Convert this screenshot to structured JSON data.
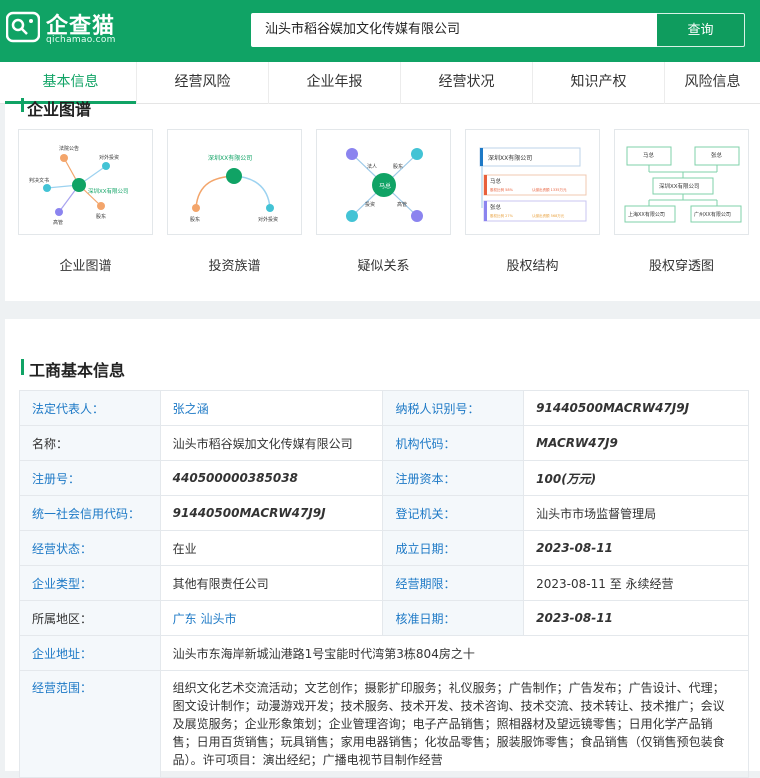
{
  "header": {
    "logo_text": "企查猫",
    "logo_sub": "qichamao.com",
    "search_value": "汕头市稻谷娱加文化传媒有限公司",
    "search_button": "查询"
  },
  "tabs": [
    "基本信息",
    "经营风险",
    "企业年报",
    "经营状况",
    "知识产权",
    "风险信息"
  ],
  "graph_section": {
    "title": "企业图谱",
    "items": [
      {
        "label": "企业图谱",
        "company": "深圳XX有限公司",
        "nodes": [
          "法院公告",
          "对外投资",
          "判决文书",
          "股东",
          "高管"
        ]
      },
      {
        "label": "投资族谱",
        "company": "深圳XX有限公司",
        "nodes": [
          "股东",
          "对外投资"
        ]
      },
      {
        "label": "疑似关系",
        "company": "马总",
        "nodes": [
          "法人",
          "股东",
          "投资",
          "高管"
        ]
      },
      {
        "label": "股权结构",
        "company": "深圳XX有限公司",
        "nodes": [
          "马总",
          "张总"
        ],
        "pcts": [
          "股权比例 58%",
          "股权比例 27%"
        ],
        "capital": [
          "认缴出资额 1335万元",
          "认缴出资额 568万元"
        ]
      },
      {
        "label": "股权穿透图",
        "company": "深圳XX有限公司",
        "nodes": [
          "马总",
          "张总",
          "上海XX有限公司",
          "广州XX有限公司"
        ]
      }
    ]
  },
  "basic_info": {
    "title": "工商基本信息",
    "rows": [
      {
        "l1": "法定代表人：",
        "v1": "张之涵",
        "l2": "纳税人识别号：",
        "v2": "91440500MACRW47J9J"
      },
      {
        "l1": "名称：",
        "v1": "汕头市稻谷娱加文化传媒有限公司",
        "l2": "机构代码：",
        "v2": "MACRW47J9"
      },
      {
        "l1": "注册号：",
        "v1": "440500000385038",
        "l2": "注册资本：",
        "v2": "100(万元)"
      },
      {
        "l1": "统一社会信用代码：",
        "v1": "91440500MACRW47J9J",
        "l2": "登记机关：",
        "v2": "汕头市市场监督管理局"
      },
      {
        "l1": "经营状态：",
        "v1": "在业",
        "l2": "成立日期：",
        "v2": "2023-08-11"
      },
      {
        "l1": "企业类型：",
        "v1": "其他有限责任公司",
        "l2": "经营期限：",
        "v2": "2023-08-11 至 永续经营"
      },
      {
        "l1": "所属地区：",
        "v1": "广东 汕头市",
        "l2": "核准日期：",
        "v2": "2023-08-11"
      }
    ],
    "address_label": "企业地址：",
    "address": "汕头市东海岸新城汕港路1号宝能时代湾第3栋804房之十",
    "scope_label": "经营范围：",
    "scope": "组织文化艺术交流活动；文艺创作；摄影扩印服务；礼仪服务；广告制作；广告发布；广告设计、代理；图文设计制作；动漫游戏开发；技术服务、技术开发、技术咨询、技术交流、技术转让、技术推广；会议及展览服务；企业形象策划；企业管理咨询；电子产品销售；照相器材及望远镜零售；日用化学产品销售；日用百货销售；玩具销售；家用电器销售；化妆品零售；服装服饰零售；食品销售（仅销售预包装食品）。许可项目：演出经纪；广播电视节目制作经营"
  }
}
